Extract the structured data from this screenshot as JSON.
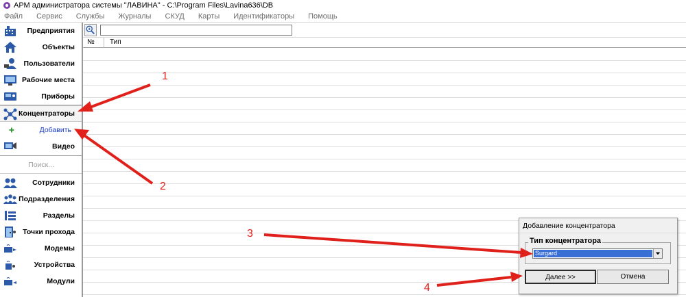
{
  "window": {
    "title": "АРМ администратора системы \"ЛАВИНА\" - C:\\Program Files\\Lavina636\\DB"
  },
  "menu": [
    "Файл",
    "Сервис",
    "Службы",
    "Журналы",
    "СКУД",
    "Карты",
    "Идентификаторы",
    "Помощь"
  ],
  "sidebar": {
    "items": [
      {
        "label": "Предприятия",
        "icon": "building-icon"
      },
      {
        "label": "Объекты",
        "icon": "house-icon"
      },
      {
        "label": "Пользователи",
        "icon": "user-icon"
      },
      {
        "label": "Рабочие места",
        "icon": "monitor-icon"
      },
      {
        "label": "Приборы",
        "icon": "device-icon"
      },
      {
        "label": "Концентраторы",
        "icon": "hub-icon"
      },
      {
        "label": "Добавить",
        "icon": "plus-icon"
      },
      {
        "label": "Видео",
        "icon": "video-icon"
      },
      {
        "label": "Поиск...",
        "icon": ""
      },
      {
        "label": "Сотрудники",
        "icon": "employees-icon"
      },
      {
        "label": "Подразделения",
        "icon": "departments-icon"
      },
      {
        "label": "Разделы",
        "icon": "sections-icon"
      },
      {
        "label": "Точки прохода",
        "icon": "door-icon"
      },
      {
        "label": "Модемы",
        "icon": "modem-icon"
      },
      {
        "label": "Устройства",
        "icon": "devices-icon"
      },
      {
        "label": "Модули",
        "icon": "modules-icon"
      }
    ]
  },
  "toolbar": {
    "search_value": ""
  },
  "table": {
    "columns": [
      "№",
      "Тип"
    ]
  },
  "annotations": [
    "1",
    "2",
    "3",
    "4"
  ],
  "dialog": {
    "title": "Добавление концентратора",
    "group_label": "Тип концентратора",
    "selected_type": "Surgard",
    "next_label": "Далее >>",
    "cancel_label": "Отмена"
  },
  "colors": {
    "arrow": "#e0201b",
    "selection": "#3a6fd6",
    "link": "#1a3cc8"
  }
}
